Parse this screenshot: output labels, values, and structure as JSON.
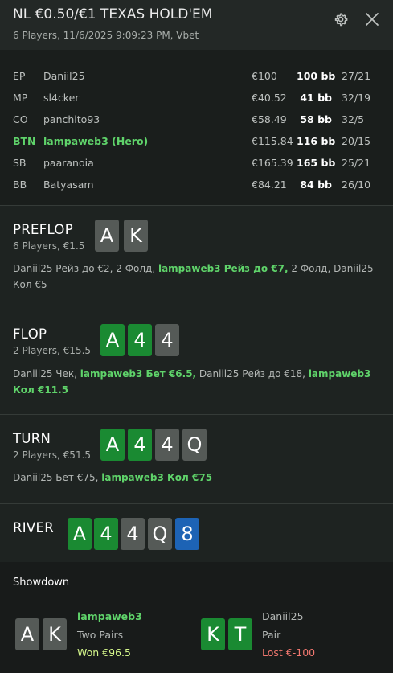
{
  "header": {
    "title": "NL €0.50/€1 TEXAS HOLD'EM",
    "subtitle": "6 Players, 11/6/2025 9:09:23 PM, Vbet"
  },
  "players": [
    {
      "pos": "EP",
      "name": "Daniil25",
      "stack": "€100",
      "bb": "100 bb",
      "stat": "27/21"
    },
    {
      "pos": "MP",
      "name": "sl4cker",
      "stack": "€40.52",
      "bb": "41 bb",
      "stat": "32/19"
    },
    {
      "pos": "CO",
      "name": "panchito93",
      "stack": "€58.49",
      "bb": "58 bb",
      "stat": "32/5"
    },
    {
      "pos": "BTN",
      "name": "lampaweb3 (Hero)",
      "stack": "€115.84",
      "bb": "116 bb",
      "stat": "20/15"
    },
    {
      "pos": "SB",
      "name": "paaranoia",
      "stack": "€165.39",
      "bb": "165 bb",
      "stat": "25/21"
    },
    {
      "pos": "BB",
      "name": "Batyasam",
      "stack": "€84.21",
      "bb": "84 bb",
      "stat": "26/10"
    }
  ],
  "preflop": {
    "name": "PREFLOP",
    "sub": "6 Players, €1.5",
    "cards": [
      {
        "rank": "A",
        "color": "grey"
      },
      {
        "rank": "K",
        "color": "grey"
      }
    ],
    "actions": [
      {
        "text": "Daniil25 Рейз до €2, 2 Фолд, ",
        "hl": false
      },
      {
        "text": "lampaweb3 Рейз до €7,",
        "hl": true
      },
      {
        "text": " 2 Фолд, Daniil25 Кол €5",
        "hl": false
      }
    ]
  },
  "flop": {
    "name": "FLOP",
    "sub": "2 Players, €15.5",
    "cards": [
      {
        "rank": "A",
        "color": "green"
      },
      {
        "rank": "4",
        "color": "green"
      },
      {
        "rank": "4",
        "color": "grey"
      }
    ],
    "actions": [
      {
        "text": "Daniil25 Чек, ",
        "hl": false
      },
      {
        "text": "lampaweb3 Бет €6.5,",
        "hl": true
      },
      {
        "text": " Daniil25 Рейз до €18, ",
        "hl": false
      },
      {
        "text": "lampaweb3 Кол €11.5",
        "hl": true
      }
    ]
  },
  "turn": {
    "name": "TURN",
    "sub": "2 Players, €51.5",
    "cards": [
      {
        "rank": "A",
        "color": "green"
      },
      {
        "rank": "4",
        "color": "green"
      },
      {
        "rank": "4",
        "color": "grey"
      },
      {
        "rank": "Q",
        "color": "grey"
      }
    ],
    "actions": [
      {
        "text": "Daniil25 Бет €75, ",
        "hl": false
      },
      {
        "text": "lampaweb3 Кол €75",
        "hl": true
      }
    ]
  },
  "river": {
    "name": "RIVER",
    "cards": [
      {
        "rank": "A",
        "color": "green"
      },
      {
        "rank": "4",
        "color": "green"
      },
      {
        "rank": "4",
        "color": "grey"
      },
      {
        "rank": "Q",
        "color": "grey"
      },
      {
        "rank": "8",
        "color": "blue"
      }
    ]
  },
  "showdown": {
    "title": "Showdown",
    "hero": {
      "name": "lampaweb3",
      "hand": "Two Pairs",
      "result": "Won €96.5",
      "cards": [
        {
          "rank": "A",
          "color": "grey"
        },
        {
          "rank": "K",
          "color": "grey"
        }
      ]
    },
    "villain": {
      "name": "Daniil25",
      "hand": "Pair",
      "result": "Lost €-100",
      "cards": [
        {
          "rank": "K",
          "color": "green"
        },
        {
          "rank": "T",
          "color": "green"
        }
      ]
    }
  },
  "colors": {
    "background": "#1e2321",
    "hero_green": "#5fd36a",
    "won": "#d3f58a",
    "lost": "#f0776f",
    "card_grey": "#555a57",
    "card_green": "#1a8a32",
    "card_blue": "#1d63b5"
  },
  "icons": {
    "settings": "gear-icon",
    "close": "close-icon"
  }
}
